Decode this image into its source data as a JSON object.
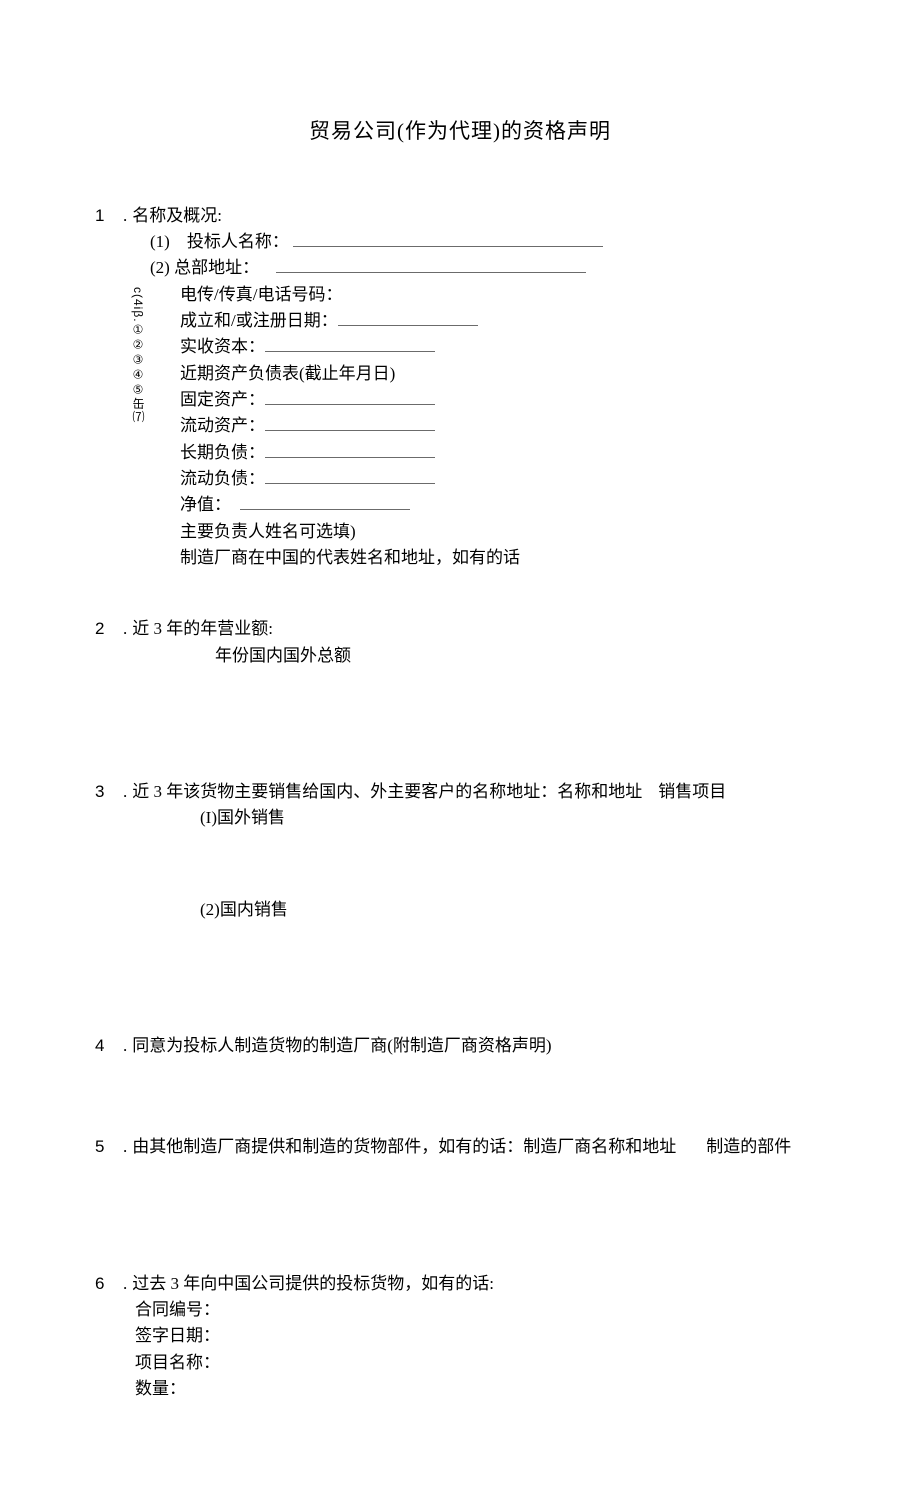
{
  "title": "贸易公司(作为代理)的资格声明",
  "s1": {
    "num": "1",
    "dot": ".",
    "label": "名称及概况:",
    "marker": "c(4iβ.①②③④⑤缶⑺",
    "i1_prefix": "(1)",
    "i1_label": "投标人名称：",
    "i2_prefix": "(2)",
    "i2_label": "总部地址：",
    "i3": "电传/传真/电话号码：",
    "i4": "成立和/或注册日期：",
    "i5": "实收资本：",
    "i6": "近期资产负债表(截止年月日)",
    "i7": "固定资产：",
    "i8": "流动资产：",
    "i9": "长期负债：",
    "i10": "流动负债：",
    "i11": "净值：",
    "i12": "主要负责人姓名可选填)",
    "i13": "制造厂商在中国的代表姓名和地址，如有的话"
  },
  "s2": {
    "num": "2",
    "dot": ".",
    "label": "近 3 年的年营业额:",
    "sub": "年份国内国外总额"
  },
  "s3": {
    "num": "3",
    "dot": ".",
    "label_a": "近 3 年该货物主要销售给国内、外主要客户的名称地址：名称和地址",
    "label_b": "销售项目",
    "sub1": "(I)国外销售",
    "sub2": "(2)国内销售"
  },
  "s4": {
    "num": "4",
    "dot": ".",
    "label": "同意为投标人制造货物的制造厂商(附制造厂商资格声明)"
  },
  "s5": {
    "num": "5",
    "dot": ".",
    "label_a": "由其他制造厂商提供和制造的货物部件，如有的话：制造厂商名称和地址",
    "label_b": "制造的部件"
  },
  "s6": {
    "num": "6",
    "dot": ".",
    "label": "过去 3 年向中国公司提供的投标货物，如有的话:",
    "l1": "合同编号：",
    "l2": "签字日期：",
    "l3": "项目名称：",
    "l4": "数量："
  }
}
